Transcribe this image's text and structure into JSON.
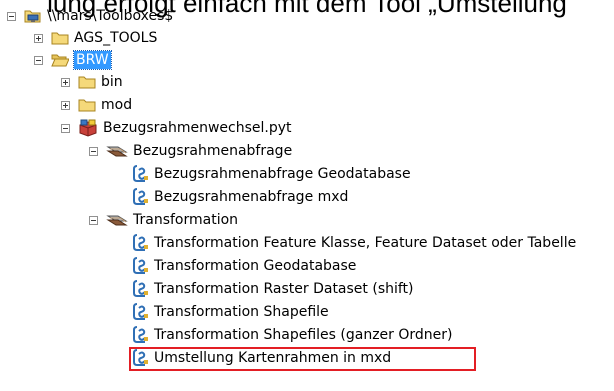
{
  "caption": "lung erfolgt einfach mit dem Tool „Umstellung",
  "colors": {
    "selection": "#3399ff",
    "highlight": "#e31e24",
    "folder": "#f5d97a",
    "tool": "#2f6fb5"
  },
  "tree": [
    {
      "label": "\\\\mars\\Toolboxes$",
      "icon": "network-folder-icon",
      "expander": "minus"
    },
    {
      "label": "AGS_TOOLS",
      "icon": "folder-icon",
      "expander": "plus"
    },
    {
      "label": "BRW",
      "icon": "open-folder-icon",
      "expander": "minus",
      "selected": true
    },
    {
      "label": "bin",
      "icon": "folder-icon",
      "expander": "plus"
    },
    {
      "label": "mod",
      "icon": "folder-icon",
      "expander": "plus"
    },
    {
      "label": "Bezugsrahmenwechsel.pyt",
      "icon": "python-toolbox-icon",
      "expander": "minus"
    },
    {
      "label": "Bezugsrahmenabfrage",
      "icon": "toolset-icon",
      "expander": "minus"
    },
    {
      "label": "Bezugsrahmenabfrage Geodatabase",
      "icon": "script-tool-icon"
    },
    {
      "label": "Bezugsrahmenabfrage mxd",
      "icon": "script-tool-icon"
    },
    {
      "label": "Transformation",
      "icon": "toolset-icon",
      "expander": "minus"
    },
    {
      "label": "Transformation Feature Klasse, Feature Dataset oder Tabelle",
      "icon": "script-tool-icon"
    },
    {
      "label": "Transformation Geodatabase",
      "icon": "script-tool-icon"
    },
    {
      "label": "Transformation Raster Dataset (shift)",
      "icon": "script-tool-icon"
    },
    {
      "label": "Transformation Shapefile",
      "icon": "script-tool-icon"
    },
    {
      "label": "Transformation Shapefiles (ganzer Ordner)",
      "icon": "script-tool-icon"
    },
    {
      "label": "Umstellung Kartenrahmen in mxd",
      "icon": "script-tool-icon",
      "highlighted": true
    }
  ]
}
